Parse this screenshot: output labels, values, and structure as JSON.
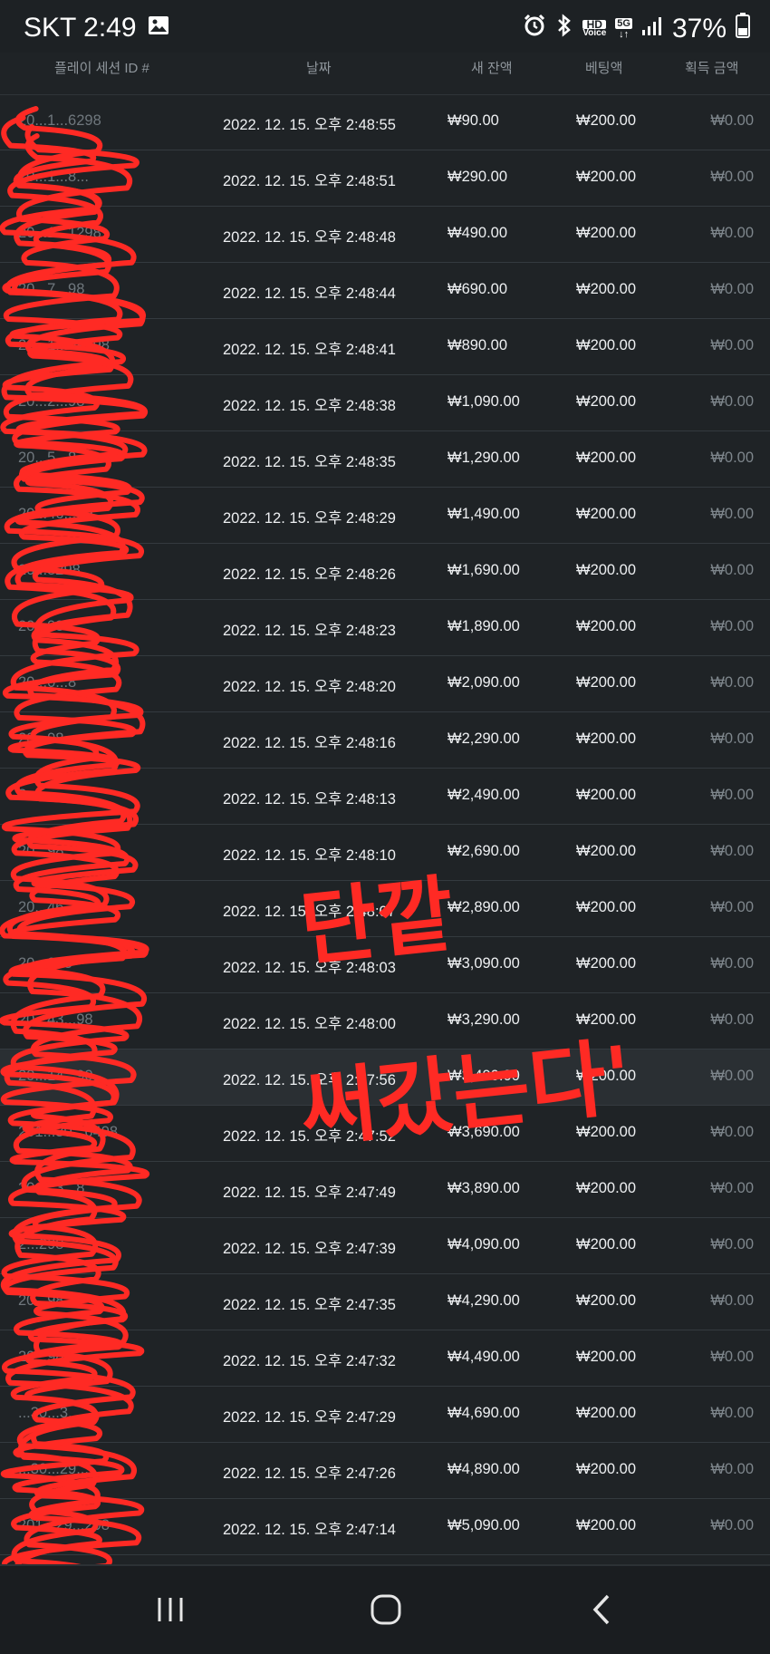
{
  "status_bar": {
    "carrier_time": "SKT 2:49",
    "battery": "37%",
    "hd_top": "HD",
    "hd_bottom": "Voice",
    "net_type": "5G",
    "icons": [
      "gallery-icon",
      "alarm-icon",
      "bluetooth-icon",
      "hd-voice-icon",
      "5g-icon",
      "signal-icon",
      "battery-icon"
    ]
  },
  "table": {
    "headers": {
      "session_id": "플레이 세션 ID #",
      "date": "날짜",
      "new_balance": "새 잔액",
      "bet": "베팅액",
      "winnings": "획득 금액"
    },
    "rows": [
      {
        "id": "20...1...6298",
        "date": "2022. 12. 15. 오후 2:48:55",
        "balance": "₩90.00",
        "bet": "₩200.00",
        "win": "₩0.00"
      },
      {
        "id": "20...1...8...",
        "date": "2022. 12. 15. 오후 2:48:51",
        "balance": "₩290.00",
        "bet": "₩200.00",
        "win": "₩0.00"
      },
      {
        "id": "20...1...1298",
        "date": "2022. 12. 15. 오후 2:48:48",
        "balance": "₩490.00",
        "bet": "₩200.00",
        "win": "₩0.00"
      },
      {
        "id": "20...7...98",
        "date": "2022. 12. 15. 오후 2:48:44",
        "balance": "₩690.00",
        "bet": "₩200.00",
        "win": "₩0.00"
      },
      {
        "id": "20...1...09298",
        "date": "2022. 12. 15. 오후 2:48:41",
        "balance": "₩890.00",
        "bet": "₩200.00",
        "win": "₩0.00"
      },
      {
        "id": "20...2...98",
        "date": "2022. 12. 15. 오후 2:48:38",
        "balance": "₩1,090.00",
        "bet": "₩200.00",
        "win": "₩0.00"
      },
      {
        "id": "20...5...8",
        "date": "2022. 12. 15. 오후 2:48:35",
        "balance": "₩1,290.00",
        "bet": "₩200.00",
        "win": "₩0.00"
      },
      {
        "id": "20...46...89...",
        "date": "2022. 12. 15. 오후 2:48:29",
        "balance": "₩1,490.00",
        "bet": "₩200.00",
        "win": "₩0.00"
      },
      {
        "id": "20...8298",
        "date": "2022. 12. 15. 오후 2:48:26",
        "balance": "₩1,690.00",
        "bet": "₩200.00",
        "win": "₩0.00"
      },
      {
        "id": "20...98",
        "date": "2022. 12. 15. 오후 2:48:23",
        "balance": "₩1,890.00",
        "bet": "₩200.00",
        "win": "₩0.00"
      },
      {
        "id": "20...0...8",
        "date": "2022. 12. 15. 오후 2:48:20",
        "balance": "₩2,090.00",
        "bet": "₩200.00",
        "win": "₩0.00"
      },
      {
        "id": "20...98",
        "date": "2022. 12. 15. 오후 2:48:16",
        "balance": "₩2,290.00",
        "bet": "₩200.00",
        "win": "₩0.00"
      },
      {
        "id": "2...",
        "date": "2022. 12. 15. 오후 2:48:13",
        "balance": "₩2,490.00",
        "bet": "₩200.00",
        "win": "₩0.00"
      },
      {
        "id": "20...98",
        "date": "2022. 12. 15. 오후 2:48:10",
        "balance": "₩2,690.00",
        "bet": "₩200.00",
        "win": "₩0.00"
      },
      {
        "id": "20...46...9...",
        "date": "2022. 12. 15. 오후 2:48:07",
        "balance": "₩2,890.00",
        "bet": "₩200.00",
        "win": "₩0.00"
      },
      {
        "id": "20...298",
        "date": "2022. 12. 15. 오후 2:48:03",
        "balance": "₩3,090.00",
        "bet": "₩200.00",
        "win": "₩0.00"
      },
      {
        "id": "20...43...98",
        "date": "2022. 12. 15. 오후 2:48:00",
        "balance": "₩3,290.00",
        "bet": "₩200.00",
        "win": "₩0.00"
      },
      {
        "id": "20...14...90...",
        "date": "2022. 12. 15. 오후 2:47:56",
        "balance": "₩3,490.00",
        "bet": "₩200.00",
        "win": "₩0.00"
      },
      {
        "id": "201...30...6498",
        "date": "2022. 12. 15. 오후 2:47:52",
        "balance": "₩3,690.00",
        "bet": "₩200.00",
        "win": "₩0.00"
      },
      {
        "id": "201...3...8",
        "date": "2022. 12. 15. 오후 2:47:49",
        "balance": "₩3,890.00",
        "bet": "₩200.00",
        "win": "₩0.00"
      },
      {
        "id": "2...298",
        "date": "2022. 12. 15. 오후 2:47:39",
        "balance": "₩4,090.00",
        "bet": "₩200.00",
        "win": "₩0.00"
      },
      {
        "id": "20...98",
        "date": "2022. 12. 15. 오후 2:47:35",
        "balance": "₩4,290.00",
        "bet": "₩200.00",
        "win": "₩0.00"
      },
      {
        "id": "20...98",
        "date": "2022. 12. 15. 오후 2:47:32",
        "balance": "₩4,490.00",
        "bet": "₩200.00",
        "win": "₩0.00"
      },
      {
        "id": "...30...3...",
        "date": "2022. 12. 15. 오후 2:47:29",
        "balance": "₩4,690.00",
        "bet": "₩200.00",
        "win": "₩0.00"
      },
      {
        "id": "...30...29...",
        "date": "2022. 12. 15. 오후 2:47:26",
        "balance": "₩4,890.00",
        "bet": "₩200.00",
        "win": "₩0.00"
      },
      {
        "id": "201...29...298",
        "date": "2022. 12. 15. 오후 2:47:14",
        "balance": "₩5,090.00",
        "bet": "₩200.00",
        "win": "₩0.00"
      }
    ],
    "highlighted_row": 17
  },
  "annotation": {
    "text_line1": "단깥",
    "text_line2": "써갔는다'",
    "color": "#ff2a24"
  },
  "colors": {
    "background": "#1f2326",
    "row_divider": "#343a3f",
    "scribble": "#ff2a24"
  },
  "nav_bar": {
    "icons": [
      "recent-apps-icon",
      "home-icon",
      "back-icon"
    ]
  }
}
